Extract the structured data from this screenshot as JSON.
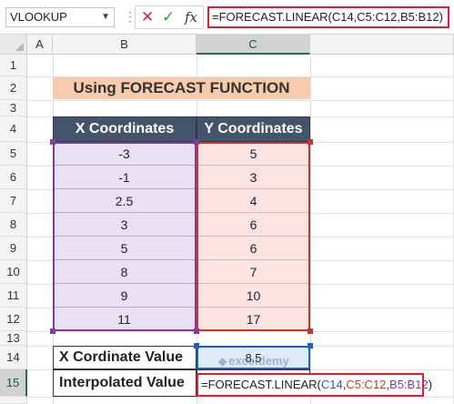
{
  "formula_bar": {
    "name_box": "VLOOKUP",
    "formula": "=FORECAST.LINEAR(C14,C5:C12,B5:B12)"
  },
  "columns": [
    "A",
    "B",
    "C"
  ],
  "rows": [
    "1",
    "2",
    "3",
    "4",
    "5",
    "6",
    "7",
    "8",
    "9",
    "10",
    "11",
    "12",
    "13",
    "14",
    "15"
  ],
  "sheet": {
    "title": "Using FORECAST FUNCTION",
    "table": {
      "headers": [
        "X Coordinates",
        "Y Coordinates"
      ],
      "rows": [
        [
          "-3",
          "5"
        ],
        [
          "-1",
          "3"
        ],
        [
          "2.5",
          "4"
        ],
        [
          "3",
          "6"
        ],
        [
          "5",
          "6"
        ],
        [
          "8",
          "7"
        ],
        [
          "9",
          "10"
        ],
        [
          "11",
          "17"
        ]
      ]
    },
    "x_value_label": "X Cordinate Value",
    "x_value": "8.5",
    "interp_label": "Interpolated Value",
    "edit_formula": {
      "prefix": "=FORECAST.LINEAR(",
      "arg1": "C14",
      "sep1": ",",
      "arg2": "C5:C12",
      "sep2": ",",
      "arg3": "B5:B12",
      "suffix": ")"
    }
  },
  "watermark": "exceldemy",
  "colors": {
    "formula_highlight": "#e21d2c",
    "title_fill": "#f8cbad",
    "header_fill": "#44546a",
    "x_fill": "#e9e1f4",
    "y_fill": "#fbe3e3",
    "value_fill": "#deeaf6"
  }
}
